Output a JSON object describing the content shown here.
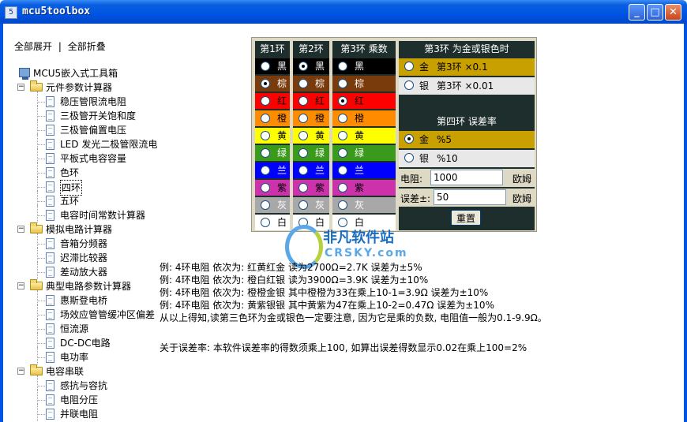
{
  "window": {
    "title": "mcu5toolbox",
    "app_icon_glyph": "5",
    "minimize_glyph": "_",
    "maximize_glyph": "□",
    "close_glyph": "✕"
  },
  "tree": {
    "expand_all": "全部展开",
    "separator": "|",
    "collapse_all": "全部折叠",
    "root": "MCU5嵌入式工具箱",
    "groups": [
      {
        "label": "元件参数计算器",
        "items": [
          "稳压管限流电阻",
          "三极管开关饱和度",
          "三极管偏置电压",
          "LED 发光二极管限流电",
          "平板式电容容量",
          "色环",
          "四环",
          "五环",
          "电容时间常数计算器"
        ]
      },
      {
        "label": "模拟电路计算器",
        "items": [
          "音箱分频器",
          "迟滞比较器",
          "差动放大器"
        ]
      },
      {
        "label": "典型电路参数计算器",
        "items": [
          "惠斯登电桥",
          "场效应管管缓冲区偏差",
          "恒流源",
          "DC-DC电路",
          "电功率"
        ]
      },
      {
        "label": "电容串联",
        "items": [
          "感抗与容抗",
          "电阻分压",
          "并联电阻"
        ]
      }
    ],
    "selected_item": "四环"
  },
  "bands": {
    "ring1_header": "第1环",
    "ring2_header": "第2环",
    "ring3_header": "第3环 乘数",
    "colors": [
      "黑",
      "棕",
      "红",
      "橙",
      "黄",
      "绿",
      "兰",
      "紫",
      "灰",
      "白"
    ],
    "ring1_selected": 1,
    "ring2_selected": 0,
    "ring3_selected": 2
  },
  "right_panel": {
    "multiplier_header": "第3环 为金或银色时",
    "gold_label": "金",
    "gold_text": "第3环 ×0.1",
    "silver_label": "银",
    "silver_text": "第3环 ×0.01",
    "tolerance_header": "第四环 误差率",
    "tol_gold_label": "金",
    "tol_gold_text": "%5",
    "tol_silver_label": "银",
    "tol_silver_text": "%10",
    "resistance_label": "电阻:",
    "resistance_value": "1000",
    "resistance_unit": "欧姆",
    "error_label": "误差±:",
    "error_value": "50",
    "error_unit": "欧姆",
    "reset_label": "重置"
  },
  "examples": [
    "例: 4环电阻 依次为: 红黄红金 读为2700Ω=2.7K 误差为±5%",
    "例: 4环电阻 依次为: 橙白红银 读为3900Ω=3.9K 误差为±10%",
    "例: 4环电阻 依次为: 橙橙金银 其中橙橙为33在乘上10-1=3.9Ω 误差为±10%",
    "例: 4环电阻 依次为: 黄紫银银 其中黄紫为47在乘上10-2=0.47Ω 误差为±10%",
    "从以上得知,读第三色环为金或银色一定要注意, 因为它是乘的负数, 电阻值一般为0.1-9.9Ω。"
  ],
  "note": "关于误差率: 本软件误差率的得数须乘上100, 如算出误差得数显示0.02在乘上100=2%",
  "watermark": {
    "line1": "非凡软件站",
    "line2": "CRSKY.com"
  }
}
